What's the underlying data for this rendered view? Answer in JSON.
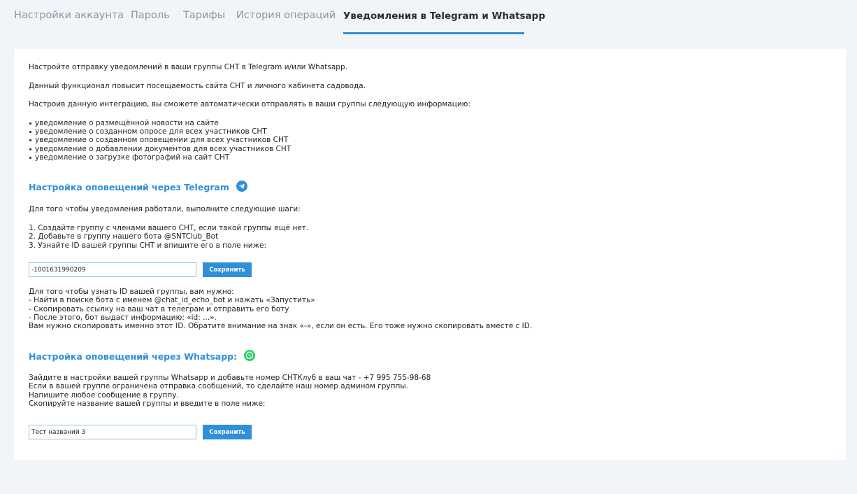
{
  "tabs": [
    {
      "label": "Настройки аккаунта",
      "active": false
    },
    {
      "label": "Пароль",
      "active": false
    },
    {
      "label": "Тарифы",
      "active": false
    },
    {
      "label": "История операций",
      "active": false
    },
    {
      "label": "Уведомления в Telegram и Whatsapp",
      "active": true
    }
  ],
  "accent_color": "#2f8fd8",
  "intro": {
    "p1": "Настройте отправку уведомлений в ваши группы СНТ в Telegram и/или Whatsapp.",
    "p2": "Данный функционал повысит посещаемость сайта СНТ и личного кабинета садовода.",
    "p3": "Настроив данную интеграцию, вы сможете автоматически отправлять в ваши группы следующую информацию:",
    "bullets": [
      "уведомление о размещённой новости на сайте",
      "уведомление о созданном опросе для всех участников СНТ",
      "уведомление о созданном оповещении для всех участников СНТ",
      "уведомление о добавлении документов для всех участников СНТ",
      "уведомление о загрузке фотографий на сайт СНТ"
    ]
  },
  "telegram": {
    "heading": "Настройка оповещений через Telegram",
    "icon": "telegram-icon",
    "steps_intro": "Для того чтобы уведомления работали, выполните следующие шаги:",
    "steps": [
      "1. Создайте группу с членами вашего СНТ, если такой группы ещё нет.",
      "2. Добавьте в группу нашего бота @SNTClub_Bot",
      "3. Узнайте ID вашей группы СНТ и впишите его в поле ниже:"
    ],
    "group_id_value": "-1001631990209",
    "save_label": "Сохранить",
    "help_lines": [
      "Для того чтобы узнать ID вашей группы, вам нужно:",
      "- Найти в поиске бота с именем @chat_id_echo_bot и нажать «Запустить»",
      "- Скопировать ссылку на ваш чат в телеграм и отправить его боту",
      "- После этого, бот выдаст информацию: «id: ...».",
      "Вам нужно скопировать именно этот ID. Обратите внимание на знак «-», если он есть. Его тоже нужно скопировать вместе с ID."
    ]
  },
  "whatsapp": {
    "heading": "Настройка оповещений через Whatsapp:",
    "icon": "whatsapp-icon",
    "lines": [
      "Зайдите в настройки вашей группы Whatsapp и добавьте номер СНТКлуб в ваш чат - +7 995 755-98-68",
      "Если в вашей группе ограничена отправка сообщений, то сделайте наш номер админом группы.",
      "Напишите любое сообщение в группу.",
      "Скопируйте название вашей группы и введите в поле ниже:"
    ],
    "group_name_value": "Тест названий 3",
    "save_label": "Сохранить"
  }
}
